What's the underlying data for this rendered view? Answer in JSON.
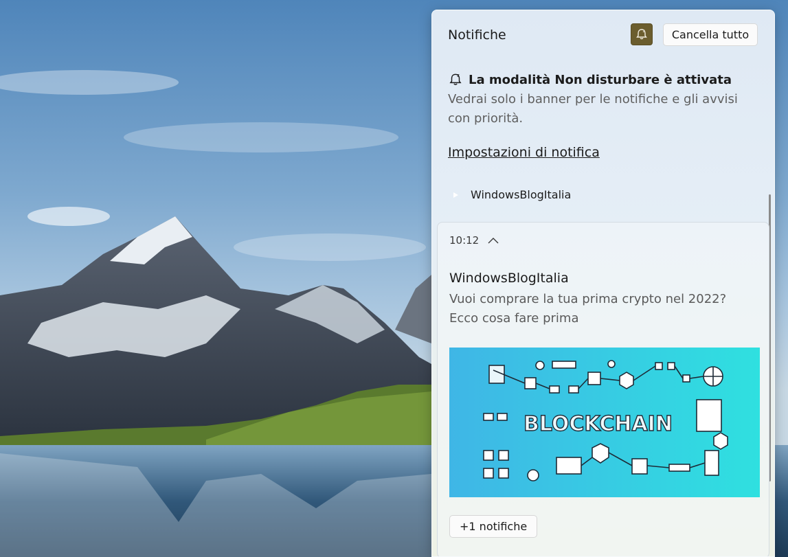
{
  "panel": {
    "title": "Notifiche",
    "clear_all_label": "Cancella tutto",
    "dnd_toggle_icon": "bell-snooze-icon",
    "dnd_toggle_color": "#6b5d2e"
  },
  "dnd_banner": {
    "icon": "bell-snooze-icon",
    "title": "La modalità Non disturbare è attivata",
    "body": "Vedrai solo i banner per le notifiche e gli avvisi con priorità."
  },
  "settings_link": "Impostazioni di notifica",
  "app_group": {
    "icon": "app-icon",
    "name": "WindowsBlogItalia"
  },
  "notification": {
    "time": "10:12",
    "collapse_icon": "chevron-up-icon",
    "sender": "WindowsBlogItalia",
    "message": "Vuoi comprare la tua prima crypto nel 2022? Ecco cosa fare prima",
    "image_text": "BLOCKCHAIN",
    "more_label": "+1 notifiche"
  }
}
